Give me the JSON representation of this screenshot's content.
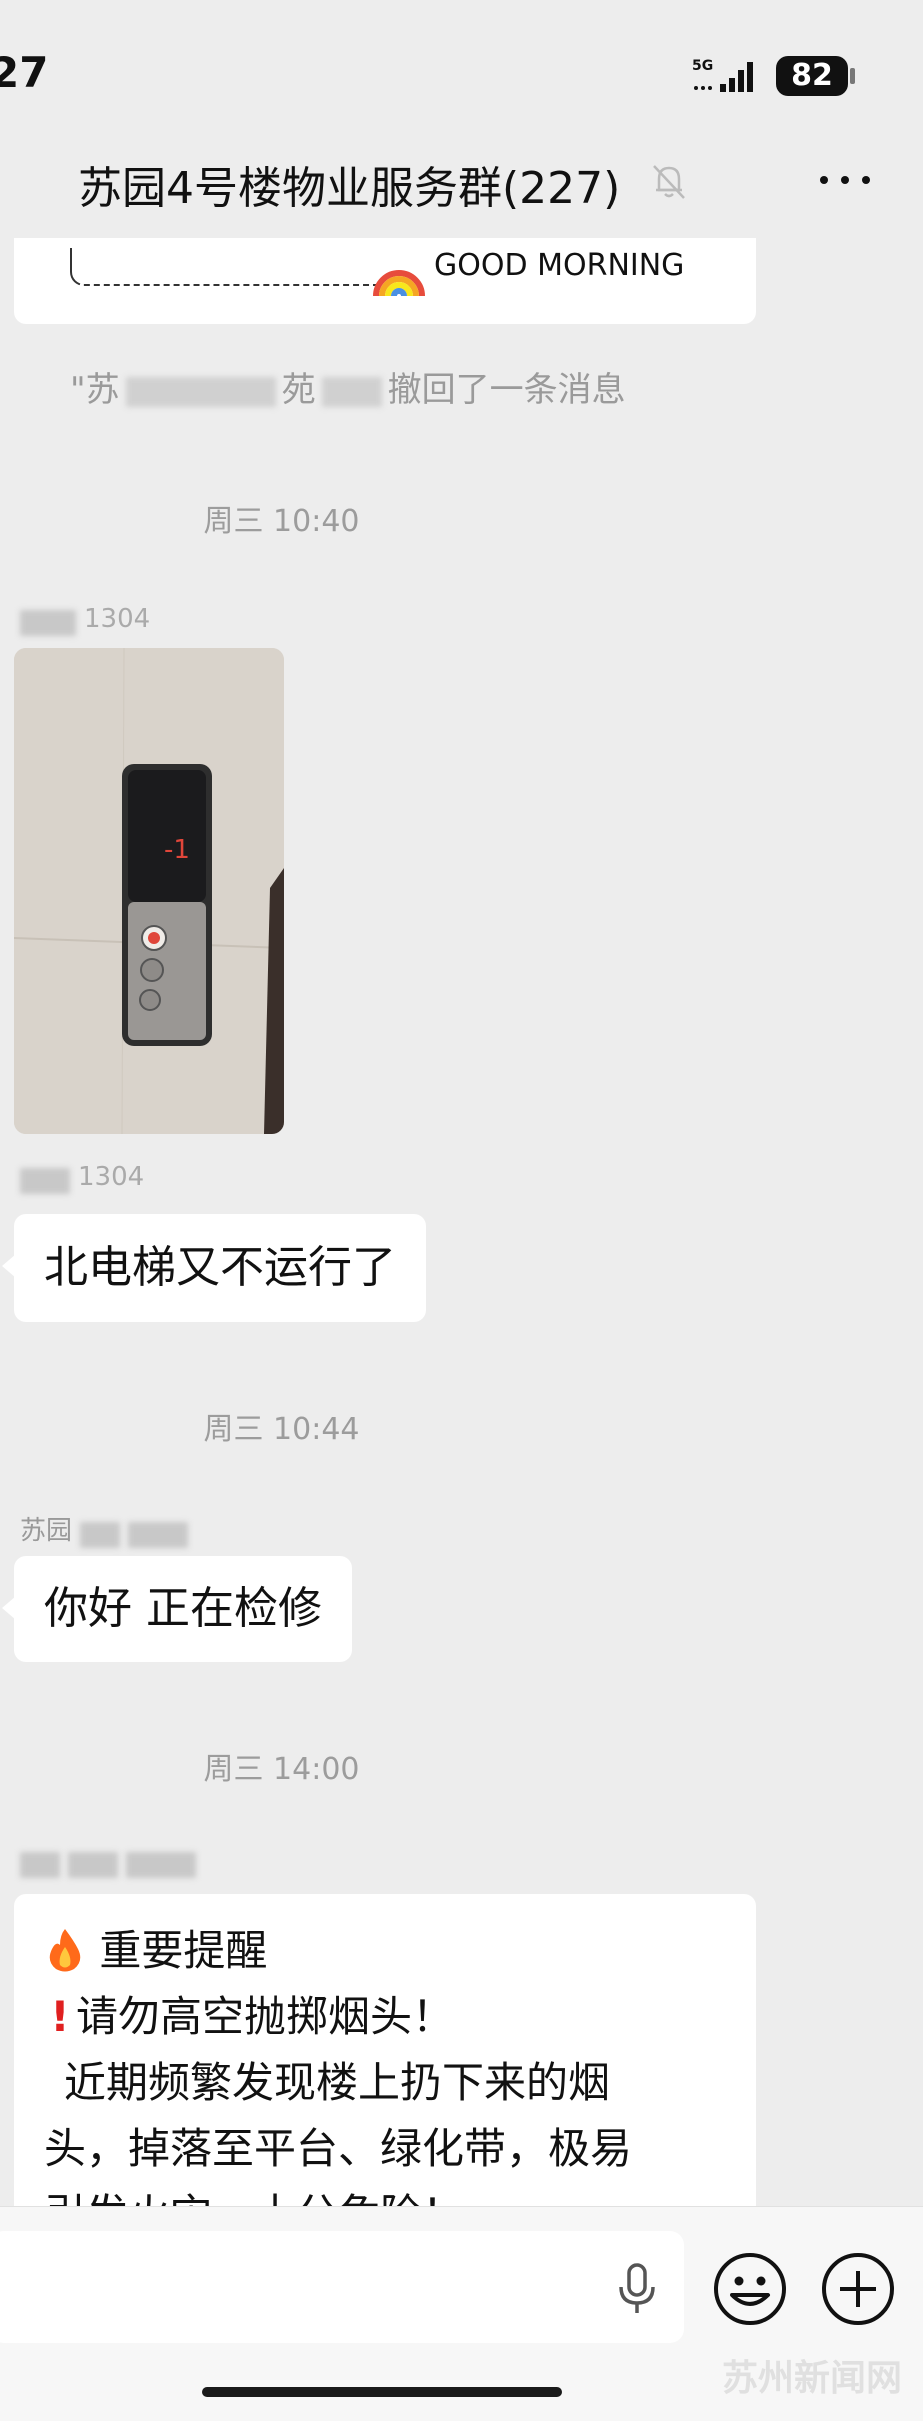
{
  "status_bar": {
    "time": "27",
    "network": "5G",
    "battery": "82"
  },
  "header": {
    "title": "苏园4号楼物业服务群(227)"
  },
  "messages": {
    "morning_card": {
      "text": "GOOD MORNING"
    },
    "recall_notice": {
      "prefix": "\"苏",
      "middle": "苑",
      "suffix": "撤回了一条消息"
    },
    "time_1": "周三 10:40",
    "photo_sender_suffix": "1304",
    "elevator_photo": {
      "display": "-1"
    },
    "elevator_sender_suffix": "1304",
    "msg_elevator": "北电梯又不运行了",
    "time_2": "周三 10:44",
    "reply_sender_prefix": "苏园",
    "msg_reply": "你好 正在检修",
    "time_3": "周三 14:00",
    "notice": {
      "line1": "重要提醒",
      "line2": "请勿高空抛掷烟头！",
      "line3": "近期频繁发现楼上扔下来的烟",
      "line4": "头，掉落至平台、绿化带，极易",
      "line5": "引发火灾，十分危险！"
    }
  },
  "input": {
    "placeholder": ""
  },
  "watermark": "苏州新闻网",
  "colors": {
    "background": "#ededed",
    "bubble": "#ffffff",
    "time_text": "#9c9c9c",
    "elevator_red": "#e0463a"
  }
}
